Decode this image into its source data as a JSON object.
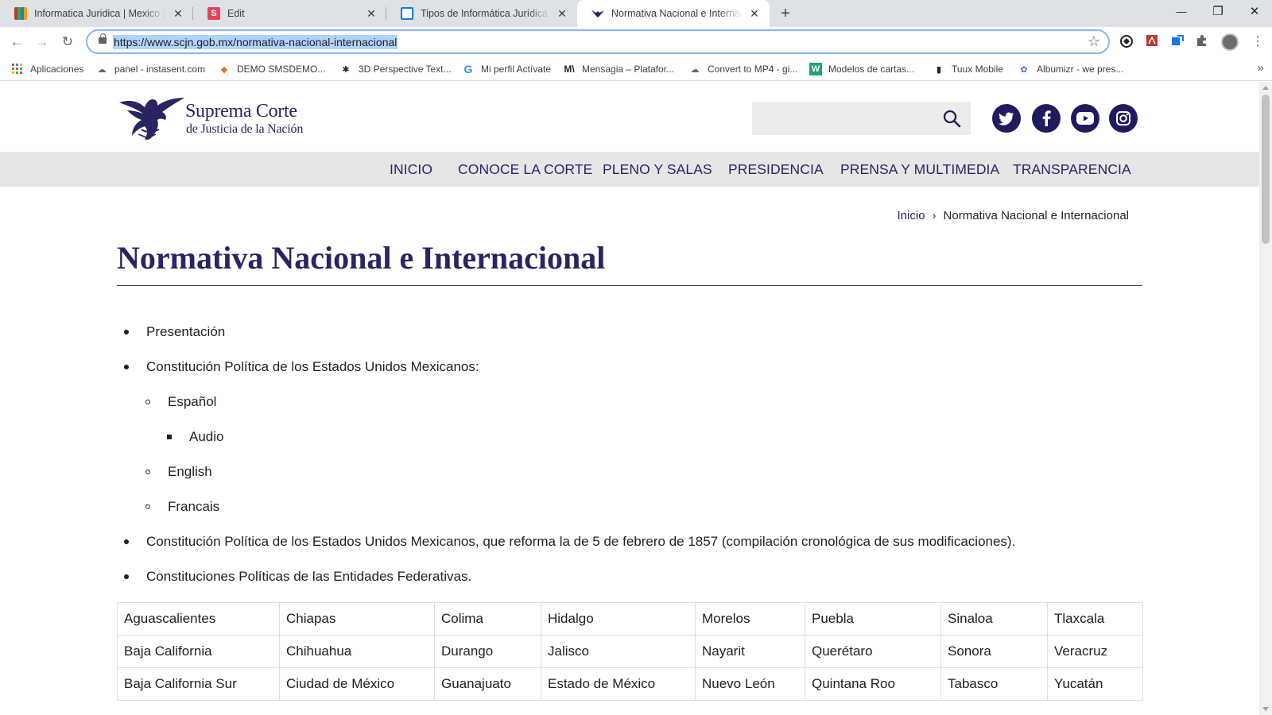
{
  "tabs": [
    {
      "title": "Informatica Juridica | Mexico | Enciclopedia Jurídica Online",
      "active": false
    },
    {
      "title": "Edit",
      "active": false
    },
    {
      "title": "Tipos de Informática Jurídica - Informática Jurídica",
      "active": false
    },
    {
      "title": "Normativa Nacional e Internacional",
      "active": true
    }
  ],
  "tab_close": "✕",
  "new_tab": "+",
  "window_controls": {
    "minimize": "—",
    "restore": "❐",
    "close": "✕"
  },
  "nav_buttons": {
    "back": "←",
    "forward": "→",
    "reload": "↻"
  },
  "address_bar": {
    "url": "https://www.scjn.gob.mx/normativa-nacional-internacional",
    "star": "☆"
  },
  "bookmarks": [
    {
      "label": "Aplicaciones",
      "icon": "apps-grid-icon"
    },
    {
      "label": "panel - instasent.com",
      "icon": "instasent-icon"
    },
    {
      "label": "DEMO SMSDEMO...",
      "icon": "sms-icon"
    },
    {
      "label": "3D Perspective Text...",
      "icon": "paw-icon"
    },
    {
      "label": "Mi perfil Actívate",
      "icon": "google-icon"
    },
    {
      "label": "Mensagia – Platafor...",
      "icon": "mensagia-icon"
    },
    {
      "label": "Convert to MP4 - gi...",
      "icon": "cloud-icon"
    },
    {
      "label": "Modelos de cartas...",
      "icon": "word-icon"
    },
    {
      "label": "Tuux Mobile",
      "icon": "tuux-icon"
    },
    {
      "label": "Albumizr - we pres...",
      "icon": "albumizr-icon"
    }
  ],
  "bookmarks_more": "»",
  "site": {
    "logo_line1": "Suprema Corte",
    "logo_line2": "de Justicia de la Nación",
    "search_placeholder": "",
    "social": [
      "twitter-icon",
      "facebook-icon",
      "youtube-icon",
      "instagram-icon"
    ],
    "menu": [
      "INICIO",
      "CONOCE LA CORTE",
      "PLENO Y SALAS",
      "PRESIDENCIA",
      "PRENSA Y MULTIMEDIA",
      "TRANSPARENCIA"
    ],
    "breadcrumb": {
      "home": "Inicio",
      "separator": "›",
      "current": "Normativa Nacional e Internacional"
    },
    "page_title": "Normativa Nacional e Internacional",
    "list": [
      {
        "text": "Presentación",
        "level": 0
      },
      {
        "text": "Constitución Política de los Estados Unidos Mexicanos:",
        "level": 0
      },
      {
        "text": "Español",
        "level": 1
      },
      {
        "text": "Audio",
        "level": 2
      },
      {
        "text": "English",
        "level": 1
      },
      {
        "text": "Francais",
        "level": 1
      },
      {
        "text": "Constitución Política de los Estados Unidos Mexicanos, que reforma la de 5 de febrero de 1857 (compilación cronológica de sus modificaciones).",
        "level": 0
      },
      {
        "text": "Constituciones Políticas de las Entidades Federativas.",
        "level": 0
      }
    ],
    "states_table": [
      [
        "Aguascalientes",
        "Chiapas",
        "Colima",
        "Hidalgo",
        "Morelos",
        "Puebla",
        "Sinaloa",
        "Tlaxcala"
      ],
      [
        "Baja California",
        "Chihuahua",
        "Durango",
        "Jalisco",
        "Nayarit",
        "Querétaro",
        "Sonora",
        "Veracruz"
      ],
      [
        "Baja California Sur",
        "Ciudad de México",
        "Guanajuato",
        "Estado de México",
        "Nuevo León",
        "Quintana Roo",
        "Tabasco",
        "Yucatán"
      ]
    ]
  },
  "colors": {
    "brand_navy": "#292563",
    "nav_bg": "#e6e6e6",
    "social_bg": "#1f1b5e",
    "url_highlight": "#b3d2fb"
  }
}
